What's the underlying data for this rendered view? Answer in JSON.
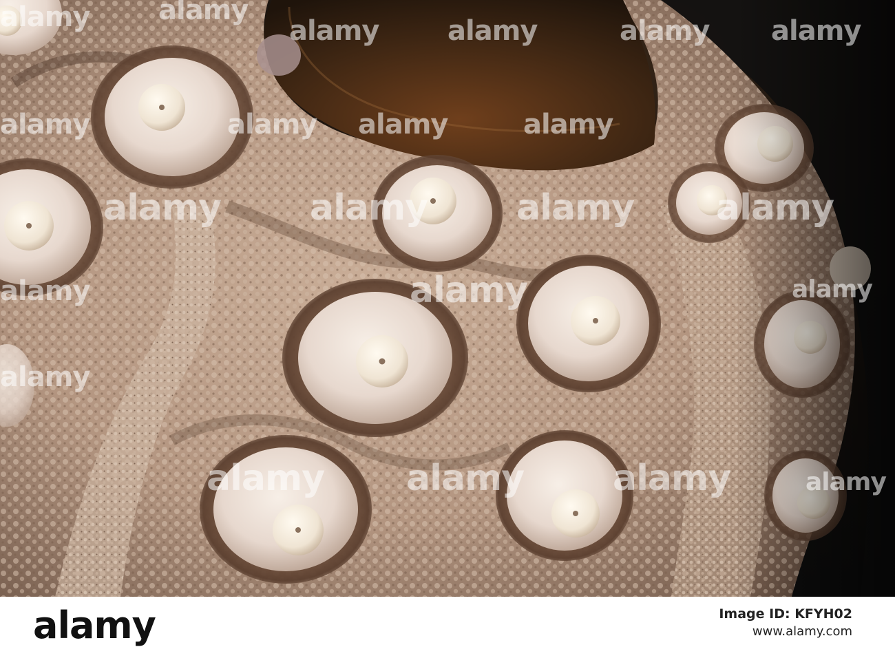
{
  "image": {
    "subject": "sea-urchin-shell-closeup",
    "colors": {
      "shell_base": "#b79b86",
      "shell_dark": "#5e4638",
      "tubercle": "#f1e9dc",
      "background": "#111111"
    }
  },
  "watermarks": [
    {
      "text": "alamy"
    },
    {
      "text": "alamy"
    },
    {
      "text": "alamy"
    },
    {
      "text": "alamy"
    },
    {
      "text": "alamy"
    },
    {
      "text": "alamy"
    },
    {
      "text": "alamy"
    },
    {
      "text": "alamy"
    },
    {
      "text": "alamy"
    },
    {
      "text": "alamy"
    },
    {
      "text": "alamy"
    },
    {
      "text": "alamy"
    },
    {
      "text": "alamy"
    },
    {
      "text": "alamy"
    },
    {
      "text": "alamy"
    },
    {
      "text": "alamy"
    },
    {
      "text": "alamy"
    },
    {
      "text": "alamy"
    },
    {
      "text": "alamy"
    },
    {
      "text": "alamy"
    },
    {
      "text": "alamy"
    },
    {
      "text": "alamy"
    }
  ],
  "footer": {
    "brand": "alamy",
    "image_id_label": "Image ID: KFYH02",
    "website": "www.alamy.com"
  }
}
